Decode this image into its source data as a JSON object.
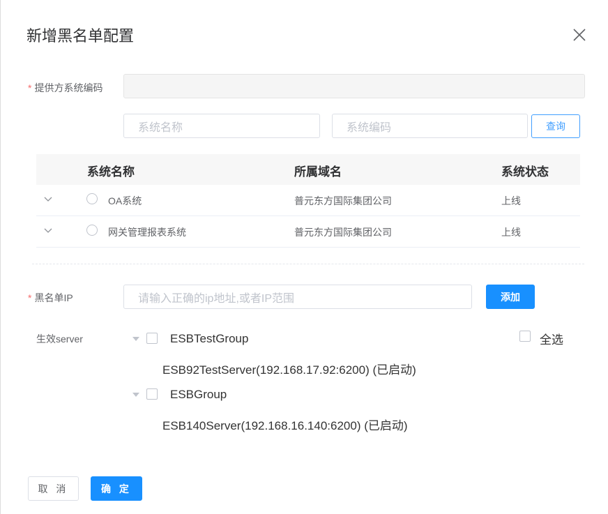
{
  "dialog": {
    "title": "新增黑名单配置"
  },
  "provider": {
    "label": "提供方系统编码",
    "required_mark": "*"
  },
  "search": {
    "name_placeholder": "系统名称",
    "code_placeholder": "系统编码",
    "query_label": "查询"
  },
  "table": {
    "headers": [
      "系统名称",
      "所属域名",
      "系统状态"
    ],
    "rows": [
      {
        "name": "OA系统",
        "domain": "普元东方国际集团公司",
        "status": "上线"
      },
      {
        "name": "网关管理报表系统",
        "domain": "普元东方国际集团公司",
        "status": "上线"
      }
    ]
  },
  "blacklist": {
    "label": "黑名单IP",
    "required_mark": "*",
    "placeholder": "请输入正确的ip地址,或者IP范围",
    "add_label": "添加"
  },
  "server": {
    "label": "生效server",
    "select_all_label": "全选",
    "groups": [
      {
        "name": "ESBTestGroup",
        "child": "ESB92TestServer(192.168.17.92:6200) (已启动)"
      },
      {
        "name": "ESBGroup",
        "child": "ESB140Server(192.168.16.140:6200) (已启动)"
      }
    ]
  },
  "footer": {
    "cancel_label": "取 消",
    "confirm_label": "确 定"
  },
  "colors": {
    "primary": "#1890ff",
    "required": "#f56c6c"
  }
}
